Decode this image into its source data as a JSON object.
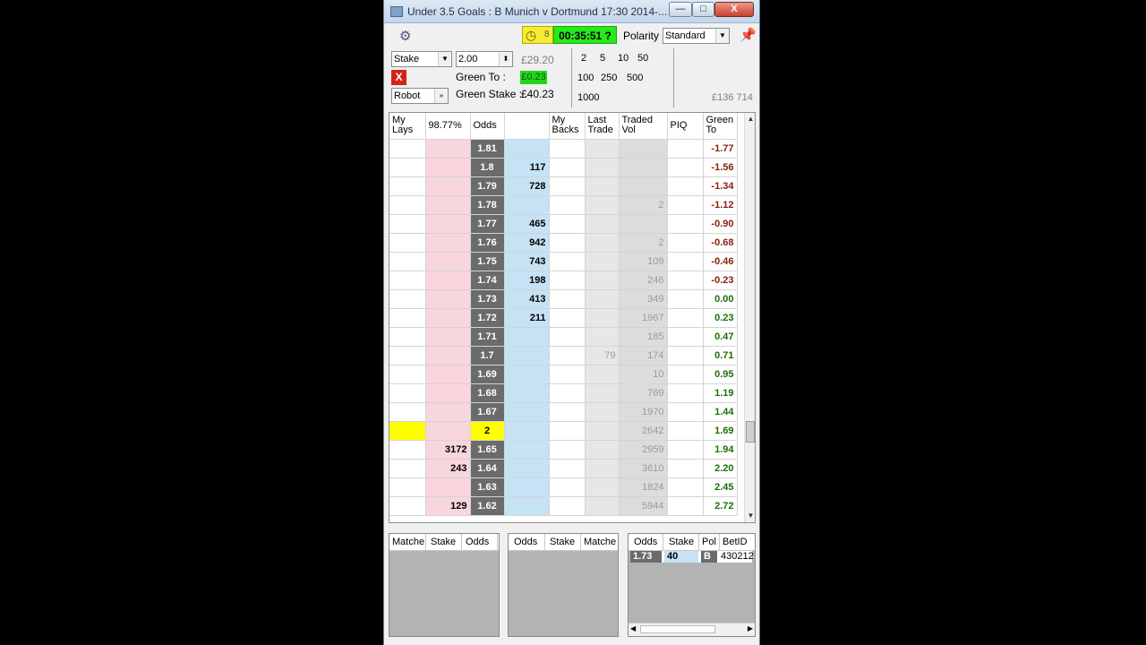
{
  "window": {
    "title": "Under 3.5 Goals : B Munich v Dortmund 17:30 2014-...",
    "minimize": "—",
    "maximize": "□",
    "close": "X"
  },
  "toolbar": {
    "timer": "00:35:51 ?",
    "clock_suffix": "8",
    "polarity_label": "Polarity",
    "polarity_value": "Standard"
  },
  "controls": {
    "mode_value": "Stake",
    "stake_value": "2.00",
    "robot_value": "Robot",
    "close_button": "X",
    "green_to_label": "Green To :",
    "green_stake_label": "Green Stake :",
    "liability": "£29.20",
    "green_to_value": "£0.23",
    "green_stake_value": "£40.23",
    "quick_stakes_row1": [
      "2",
      "5",
      "10",
      "50"
    ],
    "quick_stakes_row2": [
      "100",
      "250",
      "500"
    ],
    "quick_stakes_row3": [
      "1000"
    ],
    "market_volume": "£136 714"
  },
  "ladder": {
    "headers": {
      "my_lays": "My Lays",
      "lay_pct": "98.77%",
      "odds": "Odds",
      "back": "",
      "my_backs": "My Backs",
      "last_trade": "Last Trade",
      "traded_vol": "Traded Vol",
      "piq": "PIQ",
      "green_to": "Green To"
    },
    "rows": [
      {
        "mylay": "",
        "lay": "",
        "odds": "1.81",
        "back": "",
        "myback": "",
        "last": "",
        "vol": "",
        "piq": "",
        "green": "-1.77"
      },
      {
        "mylay": "",
        "lay": "",
        "odds": "1.8",
        "back": "117",
        "myback": "",
        "last": "",
        "vol": "",
        "piq": "",
        "green": "-1.56"
      },
      {
        "mylay": "",
        "lay": "",
        "odds": "1.79",
        "back": "728",
        "myback": "",
        "last": "",
        "vol": "",
        "piq": "",
        "green": "-1.34"
      },
      {
        "mylay": "",
        "lay": "",
        "odds": "1.78",
        "back": "",
        "myback": "",
        "last": "",
        "vol": "2",
        "piq": "",
        "green": "-1.12"
      },
      {
        "mylay": "",
        "lay": "",
        "odds": "1.77",
        "back": "465",
        "myback": "",
        "last": "",
        "vol": "",
        "piq": "",
        "green": "-0.90"
      },
      {
        "mylay": "",
        "lay": "",
        "odds": "1.76",
        "back": "942",
        "myback": "",
        "last": "",
        "vol": "2",
        "piq": "",
        "green": "-0.68"
      },
      {
        "mylay": "",
        "lay": "",
        "odds": "1.75",
        "back": "743",
        "myback": "",
        "last": "",
        "vol": "109",
        "piq": "",
        "green": "-0.46"
      },
      {
        "mylay": "",
        "lay": "",
        "odds": "1.74",
        "back": "198",
        "myback": "",
        "last": "",
        "vol": "246",
        "piq": "",
        "green": "-0.23"
      },
      {
        "mylay": "",
        "lay": "",
        "odds": "1.73",
        "back": "413",
        "myback": "",
        "last": "",
        "vol": "349",
        "piq": "",
        "green": "0.00"
      },
      {
        "mylay": "",
        "lay": "",
        "odds": "1.72",
        "back": "211",
        "myback": "",
        "last": "",
        "vol": "1967",
        "piq": "",
        "green": "0.23"
      },
      {
        "mylay": "",
        "lay": "",
        "odds": "1.71",
        "back": "",
        "myback": "",
        "last": "",
        "vol": "185",
        "piq": "",
        "green": "0.47"
      },
      {
        "mylay": "",
        "lay": "",
        "odds": "1.7",
        "back": "",
        "myback": "",
        "last": "79",
        "vol": "174",
        "piq": "",
        "green": "0.71"
      },
      {
        "mylay": "",
        "lay": "",
        "odds": "1.69",
        "back": "",
        "myback": "",
        "last": "",
        "vol": "10",
        "piq": "",
        "green": "0.95"
      },
      {
        "mylay": "",
        "lay": "",
        "odds": "1.68",
        "back": "",
        "myback": "",
        "last": "",
        "vol": "769",
        "piq": "",
        "green": "1.19"
      },
      {
        "mylay": "",
        "lay": "",
        "odds": "1.67",
        "back": "",
        "myback": "",
        "last": "",
        "vol": "1970",
        "piq": "",
        "green": "1.44"
      },
      {
        "mylay": "",
        "lay": "",
        "odds": "2",
        "back": "",
        "myback": "",
        "last": "",
        "vol": "2642",
        "piq": "",
        "green": "1.69",
        "highlight": true
      },
      {
        "mylay": "",
        "lay": "3172",
        "odds": "1.65",
        "back": "",
        "myback": "",
        "last": "",
        "vol": "2959",
        "piq": "",
        "green": "1.94"
      },
      {
        "mylay": "",
        "lay": "243",
        "odds": "1.64",
        "back": "",
        "myback": "",
        "last": "",
        "vol": "3610",
        "piq": "",
        "green": "2.20"
      },
      {
        "mylay": "",
        "lay": "",
        "odds": "1.63",
        "back": "",
        "myback": "",
        "last": "",
        "vol": "1824",
        "piq": "",
        "green": "2.45"
      },
      {
        "mylay": "",
        "lay": "129",
        "odds": "1.62",
        "back": "",
        "myback": "",
        "last": "",
        "vol": "5944",
        "piq": "",
        "green": "2.72"
      }
    ]
  },
  "panels": {
    "left_headers": [
      "Matche",
      "Stake",
      "Odds"
    ],
    "mid_headers": [
      "Odds",
      "Stake",
      "Matche"
    ],
    "right_headers": [
      "Odds",
      "Stake",
      "Pol",
      "BetID"
    ],
    "bets": [
      {
        "odds": "1.73",
        "stake": "40",
        "pol": "B",
        "betid": "430212"
      }
    ]
  }
}
